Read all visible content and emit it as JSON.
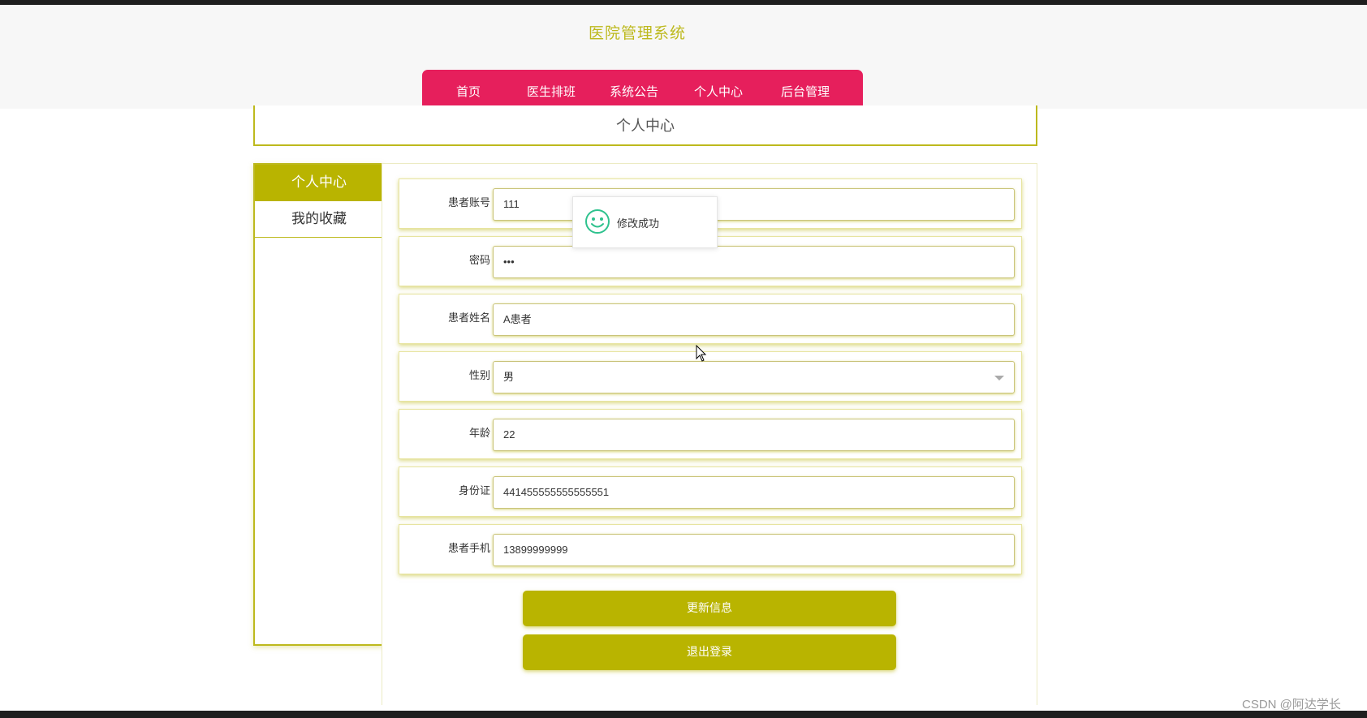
{
  "header": {
    "site_title": "医院管理系统",
    "nav": [
      "首页",
      "医生排班",
      "系统公告",
      "个人中心",
      "后台管理"
    ]
  },
  "page_title": "个人中心",
  "sidebar": {
    "items": [
      {
        "label": "个人中心",
        "active": true
      },
      {
        "label": "我的收藏",
        "active": false
      }
    ]
  },
  "form": {
    "fields": [
      {
        "label": "患者账号",
        "value": "111"
      },
      {
        "label": "密码",
        "value": "•••"
      },
      {
        "label": "患者姓名",
        "value": "A患者"
      },
      {
        "label": "性别",
        "value": "男",
        "type": "select"
      },
      {
        "label": "年龄",
        "value": "22"
      },
      {
        "label": "身份证",
        "value": "441455555555555551"
      },
      {
        "label": "患者手机",
        "value": "13899999999"
      }
    ],
    "update_button": "更新信息",
    "logout_button": "退出登录"
  },
  "toast": {
    "icon": "smile-icon",
    "message": "修改成功"
  },
  "watermark": "CSDN @阿达学长",
  "colors": {
    "accent": "#b9b400",
    "nav_bg": "#e61f5c",
    "title_color": "#bdb91d",
    "success_icon": "#2fc28e"
  }
}
